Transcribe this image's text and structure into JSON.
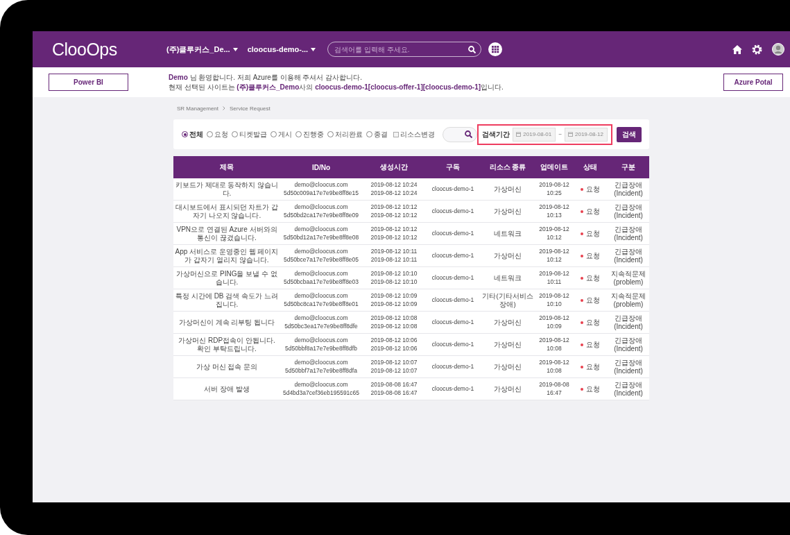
{
  "header": {
    "logo": "ClooOps",
    "site_dropdown": "(주)클루커스_De...",
    "subscription_dropdown": "cloocus-demo-...",
    "search": {
      "placeholder": "검색어를 입력해 주세요."
    }
  },
  "subbar": {
    "left_button": "Power BI",
    "messages": [
      "**Demo** 님 환영합니다. 저희 Azure를 이용해 주셔서 감사합니다.",
      "현재 선택된 사이트는 **(주)클루커스_Demo**사의 **cloocus-demo-1[cloocus-offer-1][cloocus-demo-1]**입니다."
    ],
    "right_button": "Azure Potal"
  },
  "breadcrumb": [
    "SR Management",
    "Service Request"
  ],
  "filter": {
    "status_options": [
      {
        "label": "전체",
        "selected": true
      },
      {
        "label": "요청",
        "selected": false
      },
      {
        "label": "티켓발급",
        "selected": false
      },
      {
        "label": "게시",
        "selected": false
      },
      {
        "label": "진행중",
        "selected": false
      },
      {
        "label": "처리완료",
        "selected": false
      },
      {
        "label": "종결",
        "selected": false
      }
    ],
    "resource_change": {
      "label": "리소스변경",
      "checked": false
    },
    "date_range": {
      "label": "검색기간",
      "from": "2019-08-01",
      "separator": "~",
      "to": "2019-08-12",
      "highlighted": true
    },
    "search_button": "검색"
  },
  "table": {
    "columns": [
      "제목",
      "ID/No",
      "생성시간",
      "구독",
      "리소스 종류",
      "업데이트",
      "상태",
      "구분"
    ],
    "rows": [
      {
        "title": "키보드가 제대로 동작하지 않습니다.",
        "id": "demo@cloocus.com",
        "no": "5d50c009a17e7e9be8ff8e15",
        "created": [
          "2019-08-12 10:24",
          "2019-08-12 10:24"
        ],
        "subscription": "cloocus-demo-1",
        "resource_type": "가상머신",
        "updated": [
          "2019-08-12",
          "10:25"
        ],
        "status": "요청",
        "category": [
          "긴급장애",
          "(Incident)"
        ]
      },
      {
        "title": "대시보드에서 표시되던 차트가 갑자기 나오지 않습니다.",
        "id": "demo@cloocus.com",
        "no": "5d50bd2ca17e7e9be8ff8e09",
        "created": [
          "2019-08-12 10:12",
          "2019-08-12 10:12"
        ],
        "subscription": "cloocus-demo-1",
        "resource_type": "가상머신",
        "updated": [
          "2019-08-12",
          "10:13"
        ],
        "status": "요청",
        "category": [
          "긴급장애",
          "(Incident)"
        ]
      },
      {
        "title": "VPN으로 연결된 Azure 서버와의 통신이 끊겼습니다.",
        "id": "demo@cloocus.com",
        "no": "5d50bd12a17e7e9be8ff8e08",
        "created": [
          "2019-08-12 10:12",
          "2019-08-12 10:12"
        ],
        "subscription": "cloocus-demo-1",
        "resource_type": "네트워크",
        "updated": [
          "2019-08-12",
          "10:12"
        ],
        "status": "요청",
        "category": [
          "긴급장애",
          "(Incident)"
        ]
      },
      {
        "title": "App 서비스로 운영중인 웹 페이지가 갑자기 열리지 않습니다.",
        "id": "demo@cloocus.com",
        "no": "5d50bce7a17e7e9be8ff8e05",
        "created": [
          "2019-08-12 10:11",
          "2019-08-12 10:11"
        ],
        "subscription": "cloocus-demo-1",
        "resource_type": "가상머신",
        "updated": [
          "2019-08-12",
          "10:12"
        ],
        "status": "요청",
        "category": [
          "긴급장애",
          "(Incident)"
        ]
      },
      {
        "title": "가상머신으로 PING을 보낼 수 없습니다.",
        "id": "demo@cloocus.com",
        "no": "5d50bcbaa17e7e9be8ff8e03",
        "created": [
          "2019-08-12 10:10",
          "2019-08-12 10:10"
        ],
        "subscription": "cloocus-demo-1",
        "resource_type": "네트워크",
        "updated": [
          "2019-08-12",
          "10:11"
        ],
        "status": "요청",
        "category": [
          "지속적문제",
          "(problem)"
        ]
      },
      {
        "title": "특정 시간에 DB 검색 속도가 느려집니다.",
        "id": "demo@cloocus.com",
        "no": "5d50bc8ca17e7e9be8ff8e01",
        "created": [
          "2019-08-12 10:09",
          "2019-08-12 10:09"
        ],
        "subscription": "cloocus-demo-1",
        "resource_type": "기타(기타서비스장애)",
        "updated": [
          "2019-08-12",
          "10:10"
        ],
        "status": "요청",
        "category": [
          "지속적문제",
          "(problem)"
        ]
      },
      {
        "title": "가상머신이 계속 리부팅 됩니다",
        "id": "demo@cloocus.com",
        "no": "5d50bc3ea17e7e9be8ff8dfe",
        "created": [
          "2019-08-12 10:08",
          "2019-08-12 10:08"
        ],
        "subscription": "cloocus-demo-1",
        "resource_type": "가상머신",
        "updated": [
          "2019-08-12",
          "10:09"
        ],
        "status": "요청",
        "category": [
          "긴급장애",
          "(Incident)"
        ]
      },
      {
        "title": "가상머신 RDP접속이 안됩니다. 확인 부탁드립니다.",
        "id": "demo@cloocus.com",
        "no": "5d50bbf8a17e7e9be8ff8dfb",
        "created": [
          "2019-08-12 10:06",
          "2019-08-12 10:06"
        ],
        "subscription": "cloocus-demo-1",
        "resource_type": "가상머신",
        "updated": [
          "2019-08-12",
          "10:08"
        ],
        "status": "요청",
        "category": [
          "긴급장애",
          "(Incident)"
        ]
      },
      {
        "title": "가상 머신 접속 문의",
        "id": "demo@cloocus.com",
        "no": "5d50bbf7a17e7e9be8ff8dfa",
        "created": [
          "2019-08-12 10:07",
          "2019-08-12 10:07"
        ],
        "subscription": "cloocus-demo-1",
        "resource_type": "가상머신",
        "updated": [
          "2019-08-12",
          "10:08"
        ],
        "status": "요청",
        "category": [
          "긴급장애",
          "(Incident)"
        ]
      },
      {
        "title": "서버 장애 발생",
        "id": "demo@cloocus.com",
        "no": "5d4bd3a7cef36eb195591c65",
        "created": [
          "2019-08-08 16:47",
          "2019-08-08 16:47"
        ],
        "subscription": "cloocus-demo-1",
        "resource_type": "가상머신",
        "updated": [
          "2019-08-08",
          "16:47"
        ],
        "status": "요청",
        "category": [
          "긴급장애",
          "(Incident)"
        ]
      }
    ]
  }
}
